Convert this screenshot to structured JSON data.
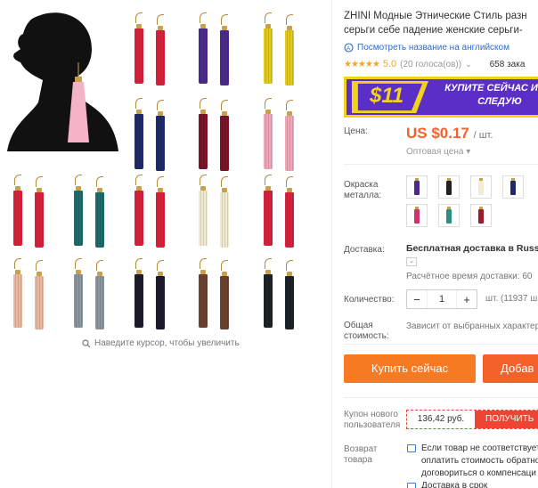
{
  "product": {
    "title_line1": "ZHINI Модные Этнические Стиль разн",
    "title_line2": "серьги себе падение женские серьги-",
    "translate_link": "Посмотреть название на английском",
    "stars": "★★★★★",
    "rating": "5.0",
    "votes": "(20 голоса(ов))",
    "orders": "658 зака"
  },
  "banner": {
    "price": "$11",
    "cta": "КУПИТЕ СЕЙЧАС И НА СЛЕДУЮ"
  },
  "price": {
    "label": "Цена:",
    "value": "US $0.17",
    "unit": "/ шт.",
    "wholesale": "Оптовая цена ▾"
  },
  "color": {
    "label": "Окраска металла:",
    "swatches": [
      "#4a2a8a",
      "#222222",
      "#f1ecd2",
      "#1e2a6a",
      "#d0326f",
      "#2d8e80",
      "#9a1c2a"
    ]
  },
  "shipping": {
    "label": "Доставка:",
    "value": "Бесплатная доставка в Russia",
    "chevron": "⌄",
    "time": "Расчётное время доставки: 60"
  },
  "quantity": {
    "label": "Количество:",
    "minus": "−",
    "value": "1",
    "plus": "+",
    "info": "шт. (11937 ш"
  },
  "total": {
    "label": "Общая стоимость:",
    "value": "Зависит от выбранных характер"
  },
  "actions": {
    "buy": "Купить сейчас",
    "cart": "Добав"
  },
  "coupon": {
    "label": "Купон нового пользователя",
    "amount": "136,42 руб.",
    "get": "ПОЛУЧИТЬ"
  },
  "returns": {
    "label": "Возврат товара",
    "text1": "Если товар не соответствует",
    "text2": "оплатить стоимость обратно",
    "text3": "договориться о компенсаци"
  },
  "delivery": {
    "text": "Доставка в срок"
  },
  "gallery": {
    "zoom_hint": "Наведите курсор, чтобы увеличить",
    "tassel_colors": [
      "#d7223d",
      "#4a2a8a",
      "#e2c91c",
      "#1e2a6a",
      "#7a1428",
      "#f0a6b8",
      "#d7223d",
      "#1d6b6a",
      "#d7223d",
      "#efe9cf",
      "#d7223d",
      "#e9b8a0",
      "#8b959e",
      "#1a1a2a",
      "#6d4130",
      "#1b2329"
    ]
  }
}
